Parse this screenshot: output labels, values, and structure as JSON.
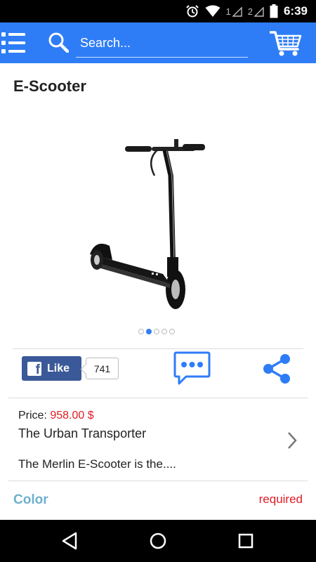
{
  "status_bar": {
    "sim1": "1",
    "sim2": "2",
    "time": "6:39"
  },
  "app_bar": {
    "search_placeholder": "Search...",
    "color": "#2f7df6"
  },
  "product": {
    "title": "E-Scooter",
    "image_icon": "scooter-image",
    "carousel": {
      "count": 5,
      "active_index": 1
    },
    "price_label": "Price:",
    "price_value": "958.00 $",
    "tagline": "The Urban Transporter",
    "description": "The Merlin E-Scooter is the...."
  },
  "social": {
    "like_label": "Like",
    "like_count": "741"
  },
  "options": {
    "color_label": "Color",
    "required_label": "required"
  },
  "colors": {
    "accent": "#2f7df6",
    "facebook": "#3b5998",
    "price": "#e01b24",
    "option_label": "#6eb0cf"
  }
}
